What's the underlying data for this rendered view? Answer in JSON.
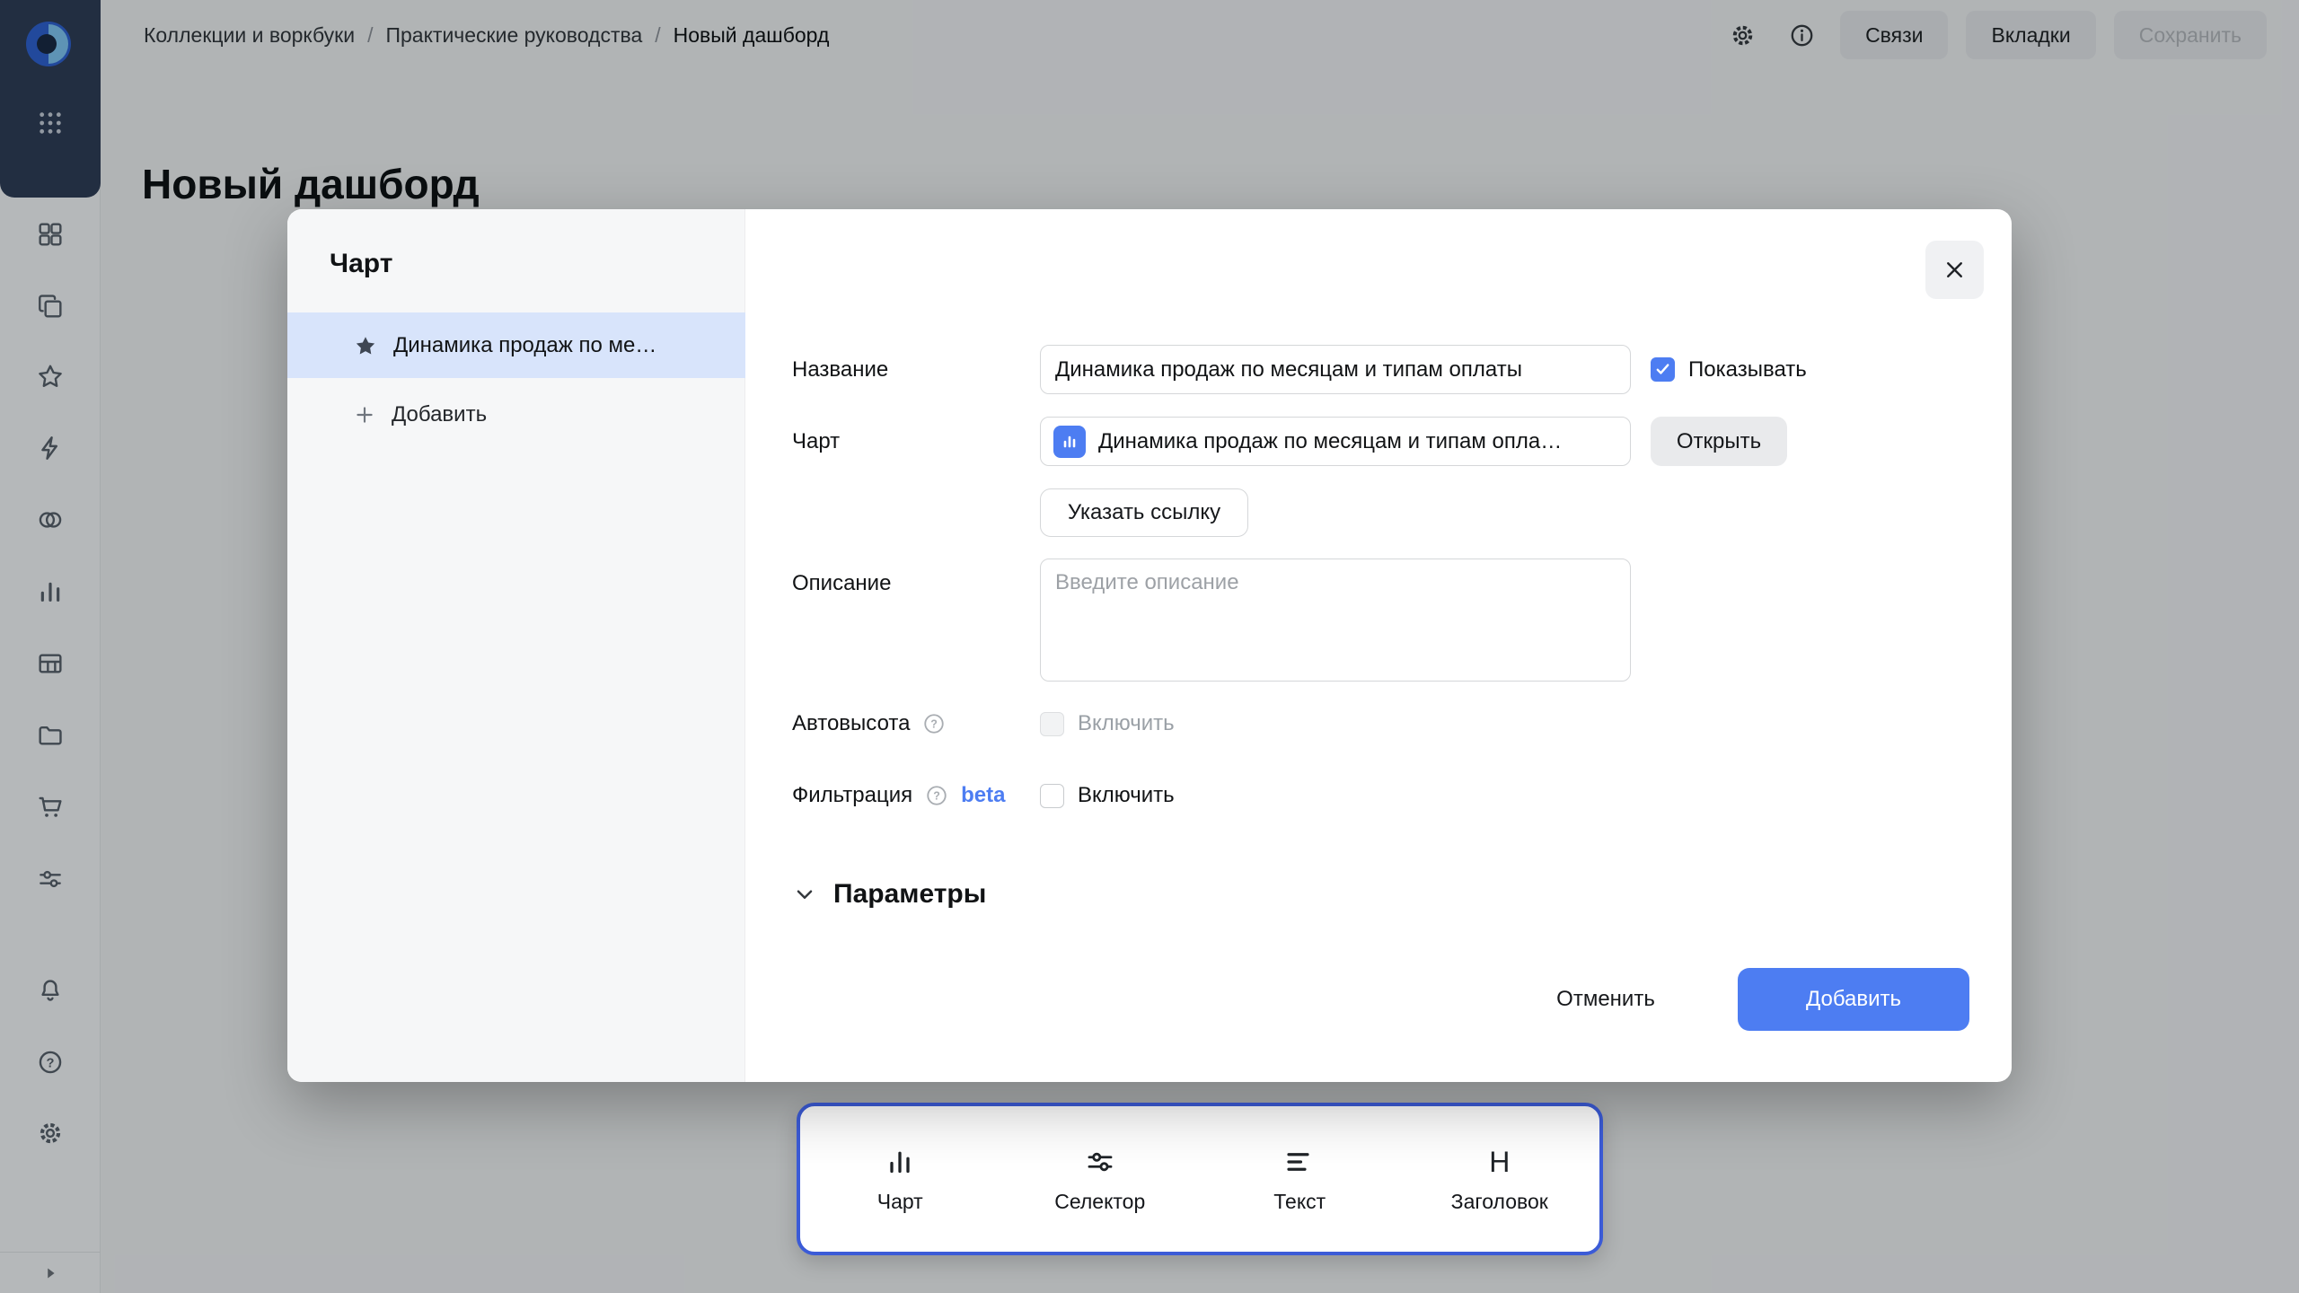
{
  "colors": {
    "accent": "#4d7df2",
    "toolbar_border": "#3b5bd7",
    "selected_item_bg": "#d8e4fb",
    "sidebar_brand_bg": "#2d3a53"
  },
  "sidebar": {
    "icons": [
      "datalens-logo-icon",
      "apps-grid-icon",
      "dashboards-grid-icon",
      "collections-copy-icon",
      "favorites-star-icon",
      "editor-lightning-icon",
      "datasets-circles-icon",
      "charts-bar-icon",
      "table-icon",
      "workbooks-folder-icon",
      "marketplace-cart-icon",
      "services-sliders-icon",
      "notifications-bell-icon",
      "help-question-icon",
      "settings-gear-icon",
      "collapse-arrow-icon"
    ]
  },
  "header": {
    "breadcrumb": [
      "Коллекции и воркбуки",
      "Практические руководства",
      "Новый дашборд"
    ],
    "separator": "/",
    "buttons": {
      "relations": "Связи",
      "tabs": "Вкладки",
      "save": "Сохранить"
    }
  },
  "page": {
    "title": "Новый дашборд"
  },
  "modal": {
    "panel": {
      "title": "Чарт",
      "item": "Динамика продаж по ме…",
      "add": "Добавить"
    },
    "form": {
      "name_label": "Название",
      "name_value": "Динамика продаж по месяцам и типам оплаты",
      "show_label": "Показывать",
      "show_checked": true,
      "chart_label": "Чарт",
      "chart_value": "Динамика продаж по месяцам и типам опла…",
      "open_button": "Открыть",
      "link_button": "Указать ссылку",
      "description_label": "Описание",
      "description_placeholder": "Введите описание",
      "autoheight_label": "Автовысота",
      "autoheight_checkbox_label": "Включить",
      "autoheight_checked": false,
      "filtering_label": "Фильтрация",
      "filtering_beta_badge": "beta",
      "filtering_checkbox_label": "Включить",
      "filtering_checked": false,
      "parameters_label": "Параметры"
    },
    "footer": {
      "cancel": "Отменить",
      "add": "Добавить"
    }
  },
  "toolbar": {
    "items": [
      {
        "label": "Чарт",
        "icon": "chart-bar-icon"
      },
      {
        "label": "Селектор",
        "icon": "selector-sliders-icon"
      },
      {
        "label": "Текст",
        "icon": "text-lines-icon"
      },
      {
        "label": "Заголовок",
        "icon": "heading-icon",
        "glyph": "H"
      }
    ]
  }
}
